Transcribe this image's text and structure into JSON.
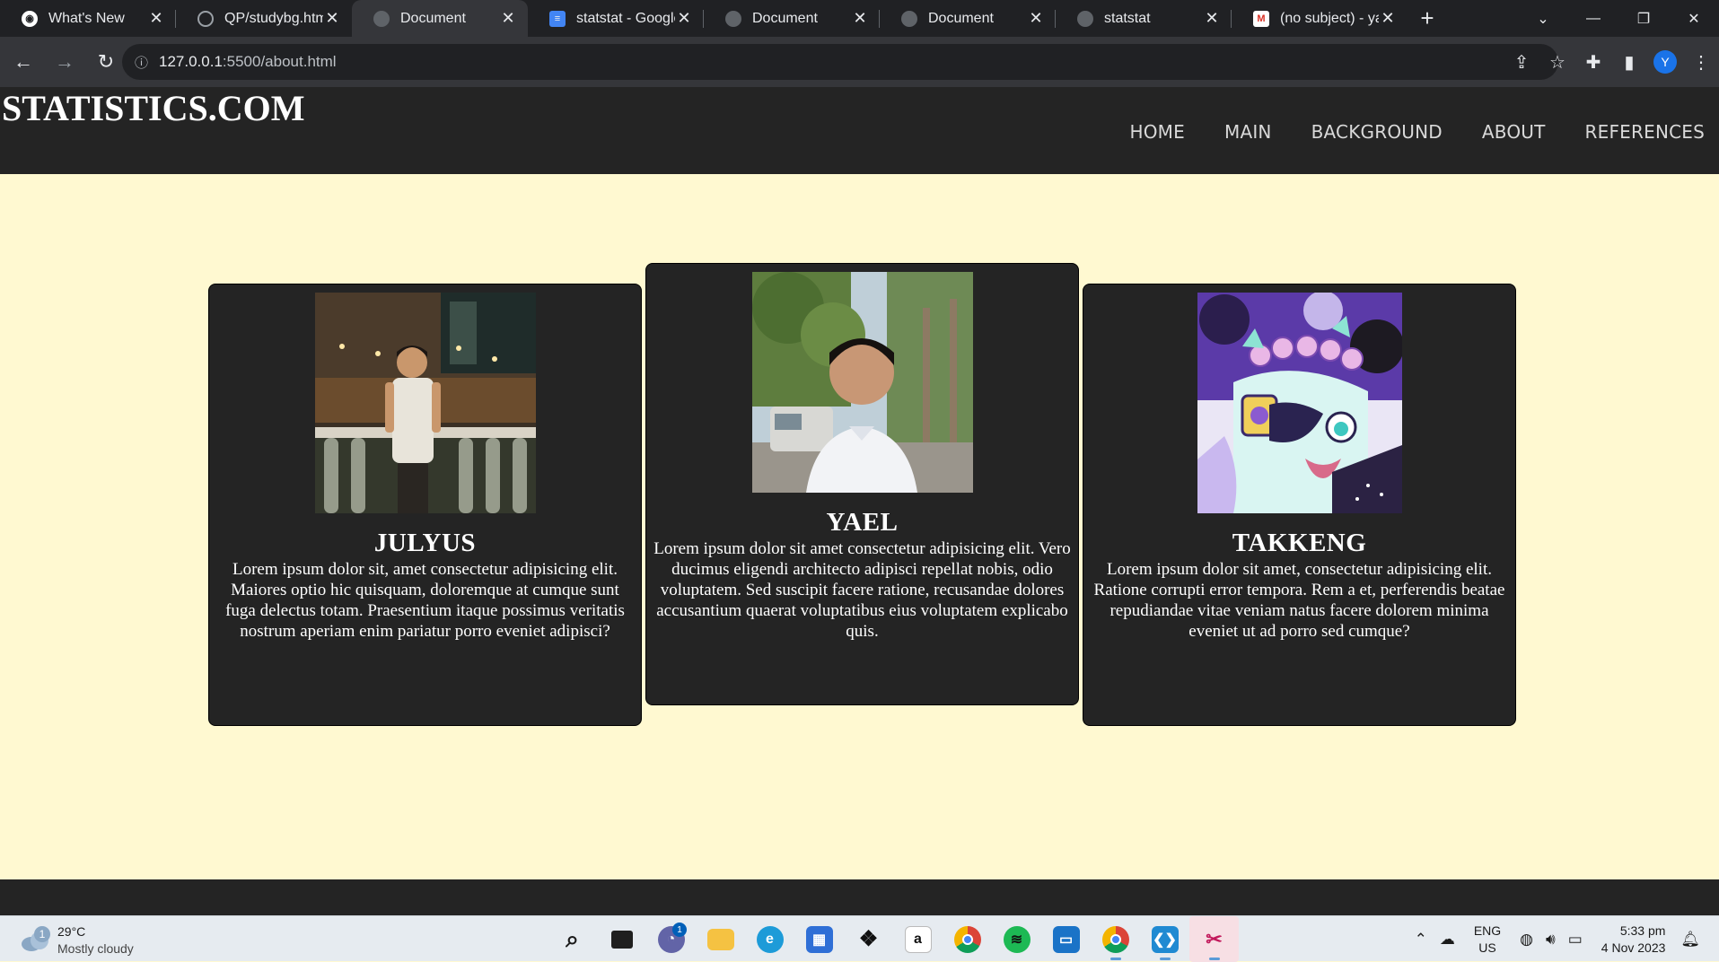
{
  "browser": {
    "tabs": [
      {
        "title": "What's New",
        "favicon": "chrome-icon",
        "active": false
      },
      {
        "title": "QP/studybg.html",
        "favicon": "github-icon",
        "active": false
      },
      {
        "title": "Document",
        "favicon": "globe-icon",
        "active": true
      },
      {
        "title": "statstat - Google",
        "favicon": "google-docs-icon",
        "active": false
      },
      {
        "title": "Document",
        "favicon": "globe-icon",
        "active": false
      },
      {
        "title": "Document",
        "favicon": "globe-icon",
        "active": false
      },
      {
        "title": "statstat",
        "favicon": "globe-icon",
        "active": false
      },
      {
        "title": "(no subject) - yae",
        "favicon": "gmail-icon",
        "active": false
      }
    ],
    "url_host": "127.0.0.1",
    "url_rest": ":5500/about.html",
    "profile_initial": "Y"
  },
  "site": {
    "logo": "STATISTICS.COM",
    "nav": [
      "HOME",
      "MAIN",
      "BACKGROUND",
      "ABOUT",
      "REFERENCES"
    ]
  },
  "cards": [
    {
      "name": "JULYUS",
      "bio": "Lorem ipsum dolor sit, amet consectetur adipisicing elit. Maiores optio hic quisquam, doloremque at cumque sunt fuga delectus totam. Praesentium itaque possimus veritatis nostrum aperiam enim pariatur porro eveniet adipisci?"
    },
    {
      "name": "YAEL",
      "bio": "Lorem ipsum dolor sit amet consectetur adipisicing elit. Vero ducimus eligendi architecto adipisci repellat nobis, odio voluptatem. Sed suscipit facere ratione, recusandae dolores accusantium quaerat voluptatibus eius voluptatem explicabo quis."
    },
    {
      "name": "TAKKENG",
      "bio": "Lorem ipsum dolor sit amet, consectetur adipisicing elit. Ratione corrupti error tempora. Rem a et, perferendis beatae repudiandae vitae veniam natus facere dolorem minima eveniet ut ad porro sed cumque?"
    }
  ],
  "taskbar": {
    "weather_temp": "29°C",
    "weather_desc": "Mostly cloudy",
    "weather_badge": "1",
    "chat_badge": "1",
    "lang_top": "ENG",
    "lang_bottom": "US",
    "time": "5:33 pm",
    "date": "4 Nov 2023"
  },
  "colors": {
    "page_bg": "#fff9d1",
    "header_bg": "#242424",
    "card_bg": "#242424"
  }
}
